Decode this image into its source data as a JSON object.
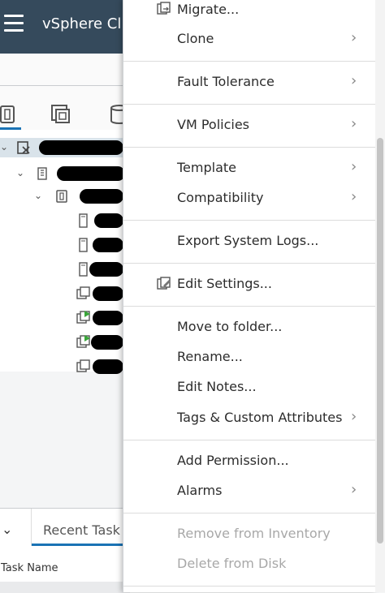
{
  "header": {
    "title": "vSphere Cl"
  },
  "bottom_panel": {
    "recent_tasks_tab": "Recent Task",
    "column_task_name": "Task Name"
  },
  "context_menu": {
    "items": [
      {
        "label": "Migrate...",
        "has_submenu": false,
        "disabled": false,
        "icon": "migrate-icon"
      },
      {
        "label": "Clone",
        "has_submenu": true,
        "disabled": false
      },
      {
        "label": "Fault Tolerance",
        "has_submenu": true,
        "disabled": false
      },
      {
        "label": "VM Policies",
        "has_submenu": true,
        "disabled": false
      },
      {
        "label": "Template",
        "has_submenu": true,
        "disabled": false
      },
      {
        "label": "Compatibility",
        "has_submenu": true,
        "disabled": false
      },
      {
        "label": "Export System Logs...",
        "has_submenu": false,
        "disabled": false
      },
      {
        "label": "Edit Settings...",
        "has_submenu": false,
        "disabled": false,
        "icon": "edit-settings-icon"
      },
      {
        "label": "Move to folder...",
        "has_submenu": false,
        "disabled": false
      },
      {
        "label": "Rename...",
        "has_submenu": false,
        "disabled": false
      },
      {
        "label": "Edit Notes...",
        "has_submenu": false,
        "disabled": false
      },
      {
        "label": "Tags & Custom Attributes",
        "has_submenu": true,
        "disabled": false
      },
      {
        "label": "Add Permission...",
        "has_submenu": false,
        "disabled": false
      },
      {
        "label": "Alarms",
        "has_submenu": true,
        "disabled": false
      },
      {
        "label": "Remove from Inventory",
        "has_submenu": false,
        "disabled": true
      },
      {
        "label": "Delete from Disk",
        "has_submenu": false,
        "disabled": true
      }
    ]
  },
  "colors": {
    "header_bg": "#354a5c",
    "accent": "#1a73b5",
    "disabled_text": "#a8a8a8"
  }
}
